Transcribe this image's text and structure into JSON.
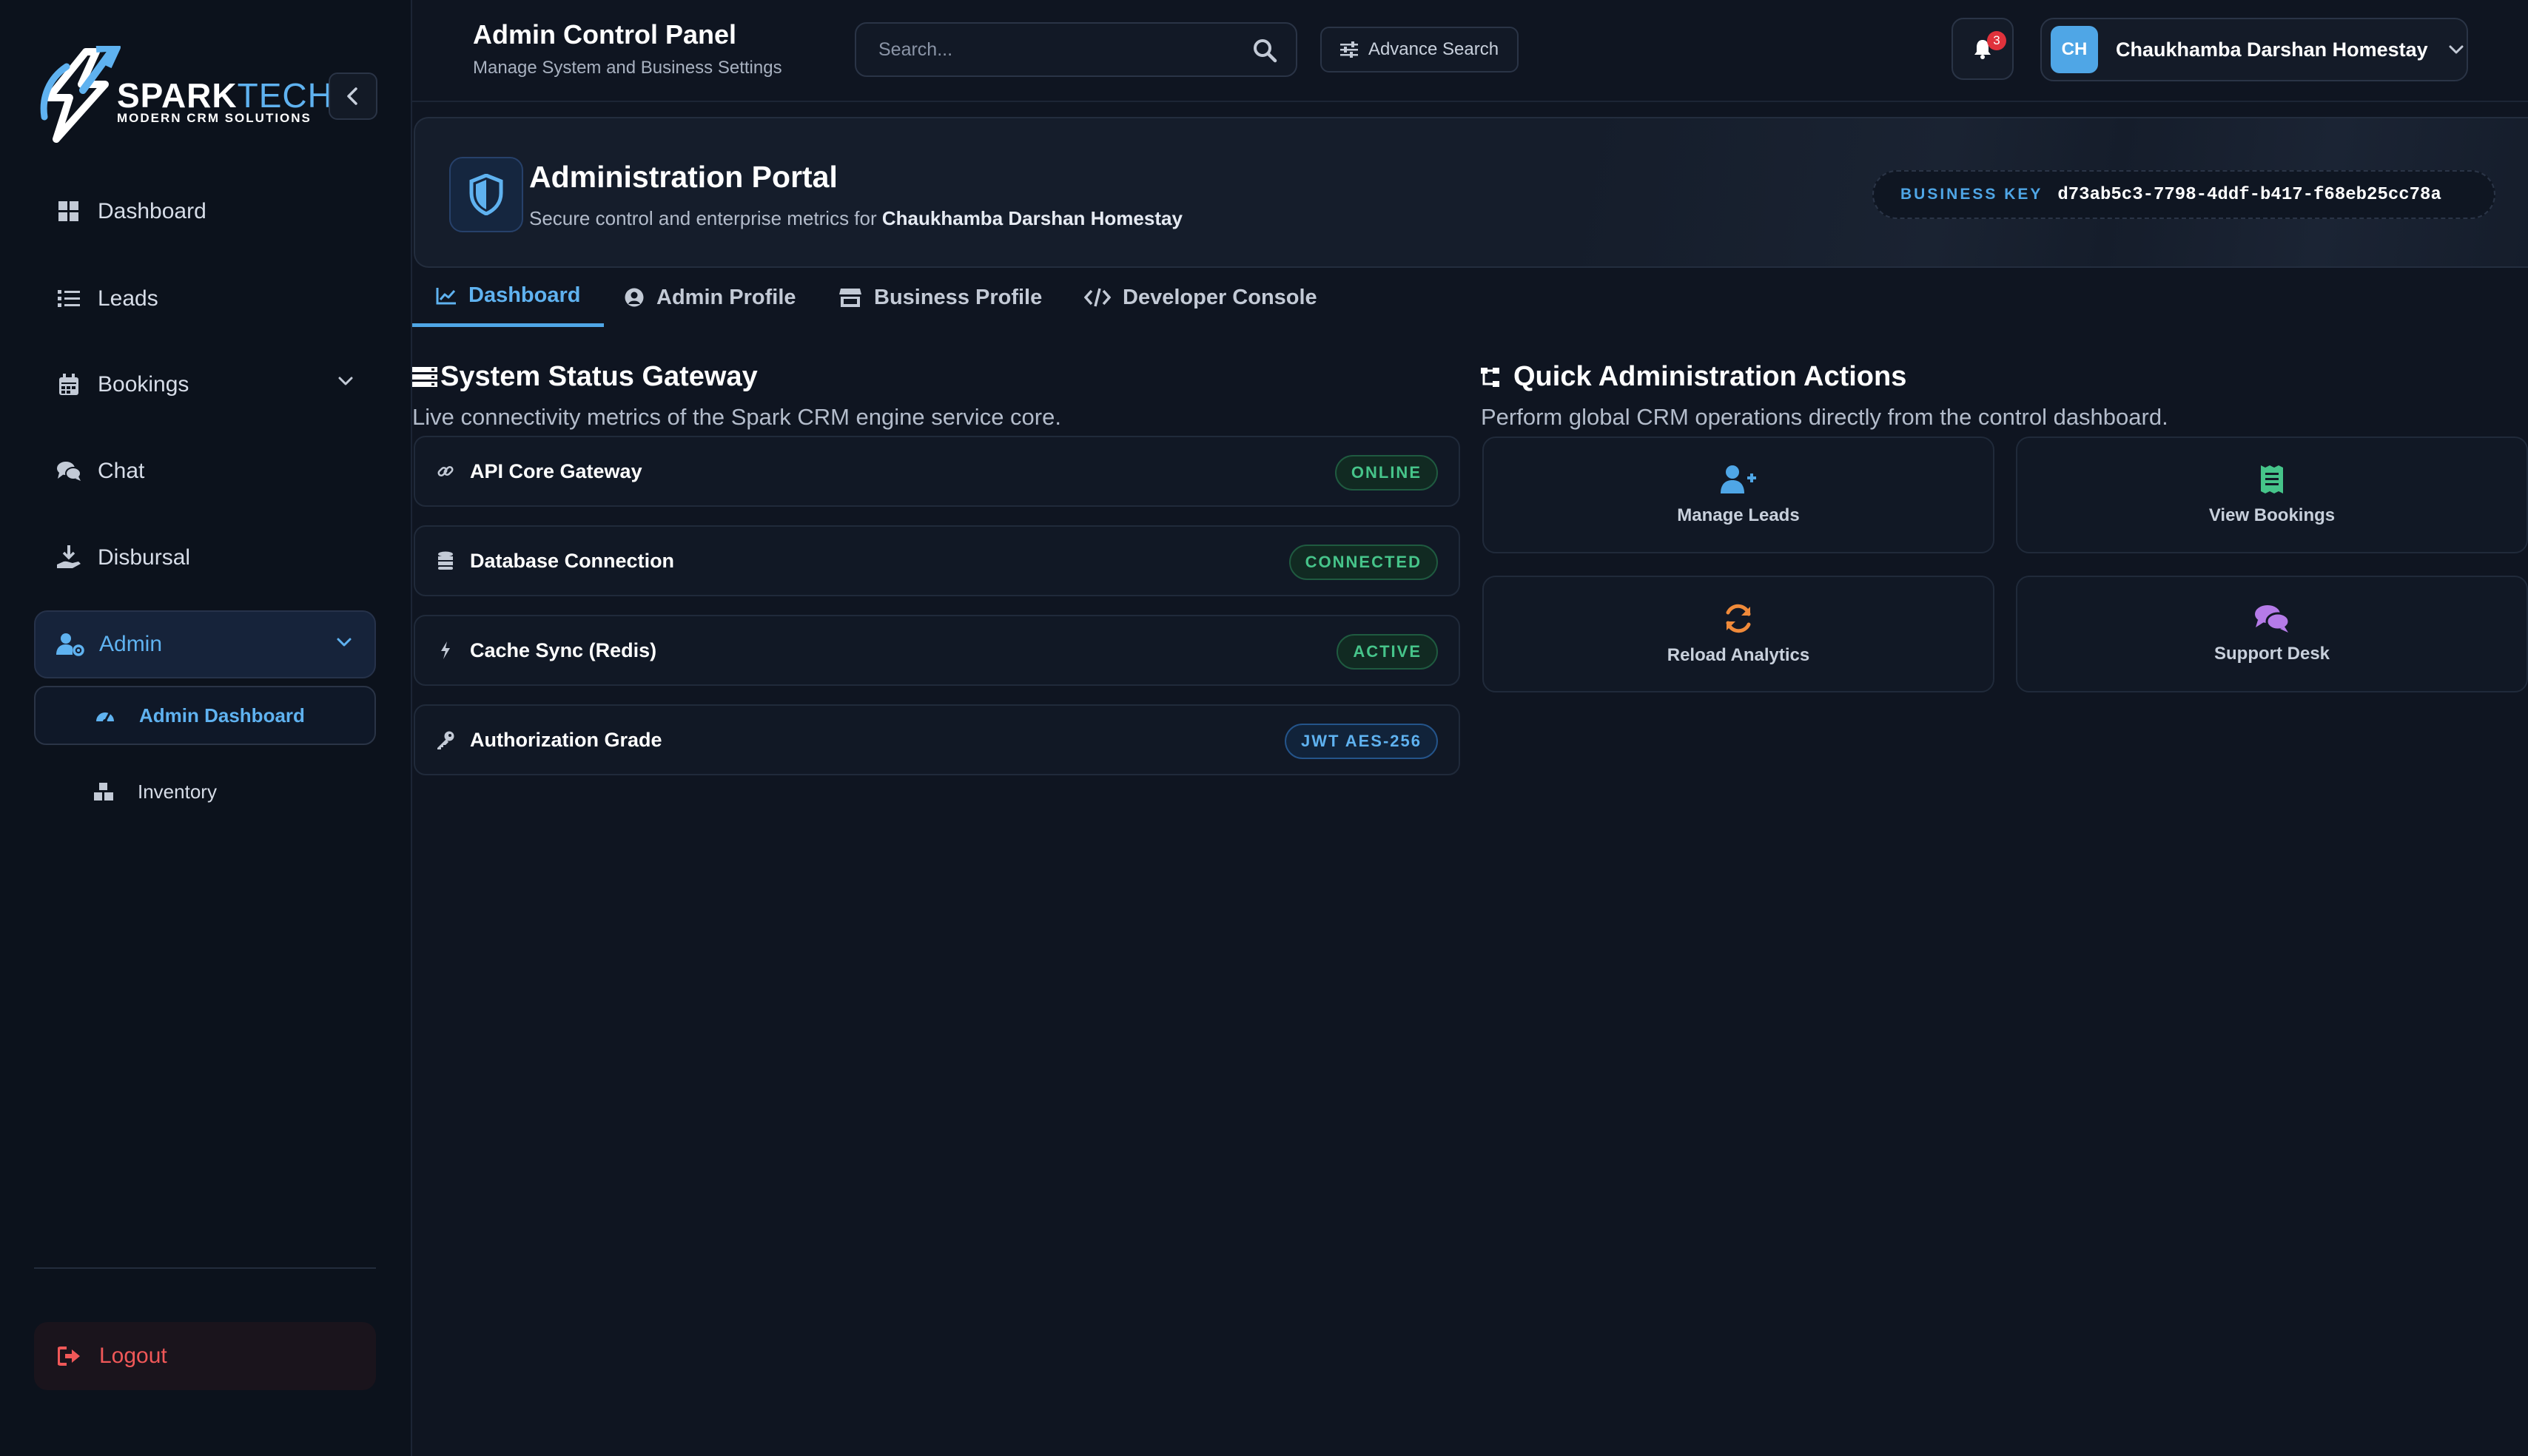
{
  "colors": {
    "accent": "#4fa6e6",
    "success": "#46c48a",
    "danger": "#f05858",
    "background": "#0f1521",
    "sidebar": "#0c121c"
  },
  "sidebar": {
    "brand": {
      "spark": "SPARK",
      "tech": "TECH",
      "tagline": "MODERN CRM SOLUTIONS"
    },
    "items": [
      {
        "label": "Dashboard",
        "icon": "grid-icon"
      },
      {
        "label": "Leads",
        "icon": "list-icon"
      },
      {
        "label": "Bookings",
        "icon": "calendar-icon"
      },
      {
        "label": "Chat",
        "icon": "chat-icon"
      },
      {
        "label": "Disbursal",
        "icon": "hand-coin-icon"
      },
      {
        "label": "Admin",
        "icon": "user-gear-icon"
      }
    ],
    "admin_sub": [
      {
        "label": "Admin Dashboard",
        "icon": "gauge-icon"
      },
      {
        "label": "Inventory",
        "icon": "boxes-icon"
      }
    ],
    "logout": "Logout"
  },
  "header": {
    "title": "Admin Control Panel",
    "subtitle": "Manage System and Business Settings",
    "search_placeholder": "Search...",
    "advance_search": "Advance Search",
    "notification_count": "3",
    "user_initials": "CH",
    "user_name": "Chaukhamba Darshan Homestay"
  },
  "portal": {
    "title": "Administration Portal",
    "subtitle_prefix": "Secure control and enterprise metrics for",
    "business_name": "Chaukhamba Darshan Homestay",
    "business_key_label": "BUSINESS KEY",
    "business_key": "d73ab5c3-7798-4ddf-b417-f68eb25cc78a"
  },
  "tabs": [
    {
      "label": "Dashboard",
      "icon": "chart-line-icon",
      "active": true
    },
    {
      "label": "Admin Profile",
      "icon": "user-circle-icon",
      "active": false
    },
    {
      "label": "Business Profile",
      "icon": "store-icon",
      "active": false
    },
    {
      "label": "Developer Console",
      "icon": "code-icon",
      "active": false
    }
  ],
  "status": {
    "title": "System Status Gateway",
    "subtitle": "Live connectivity metrics of the Spark CRM engine service core.",
    "rows": [
      {
        "label": "API Core Gateway",
        "status": "ONLINE",
        "icon": "link-icon"
      },
      {
        "label": "Database Connection",
        "status": "CONNECTED",
        "icon": "database-icon"
      },
      {
        "label": "Cache Sync (Redis)",
        "status": "ACTIVE",
        "icon": "bolt-icon"
      },
      {
        "label": "Authorization Grade",
        "status": "JWT AES-256",
        "icon": "key-icon"
      }
    ]
  },
  "actions": {
    "title": "Quick Administration Actions",
    "subtitle": "Perform global CRM operations directly from the control dashboard.",
    "cards": [
      {
        "label": "Manage Leads",
        "icon": "user-plus-icon"
      },
      {
        "label": "View Bookings",
        "icon": "receipt-icon"
      },
      {
        "label": "Reload Analytics",
        "icon": "refresh-icon"
      },
      {
        "label": "Support Desk",
        "icon": "chat-bubbles-icon"
      }
    ]
  }
}
